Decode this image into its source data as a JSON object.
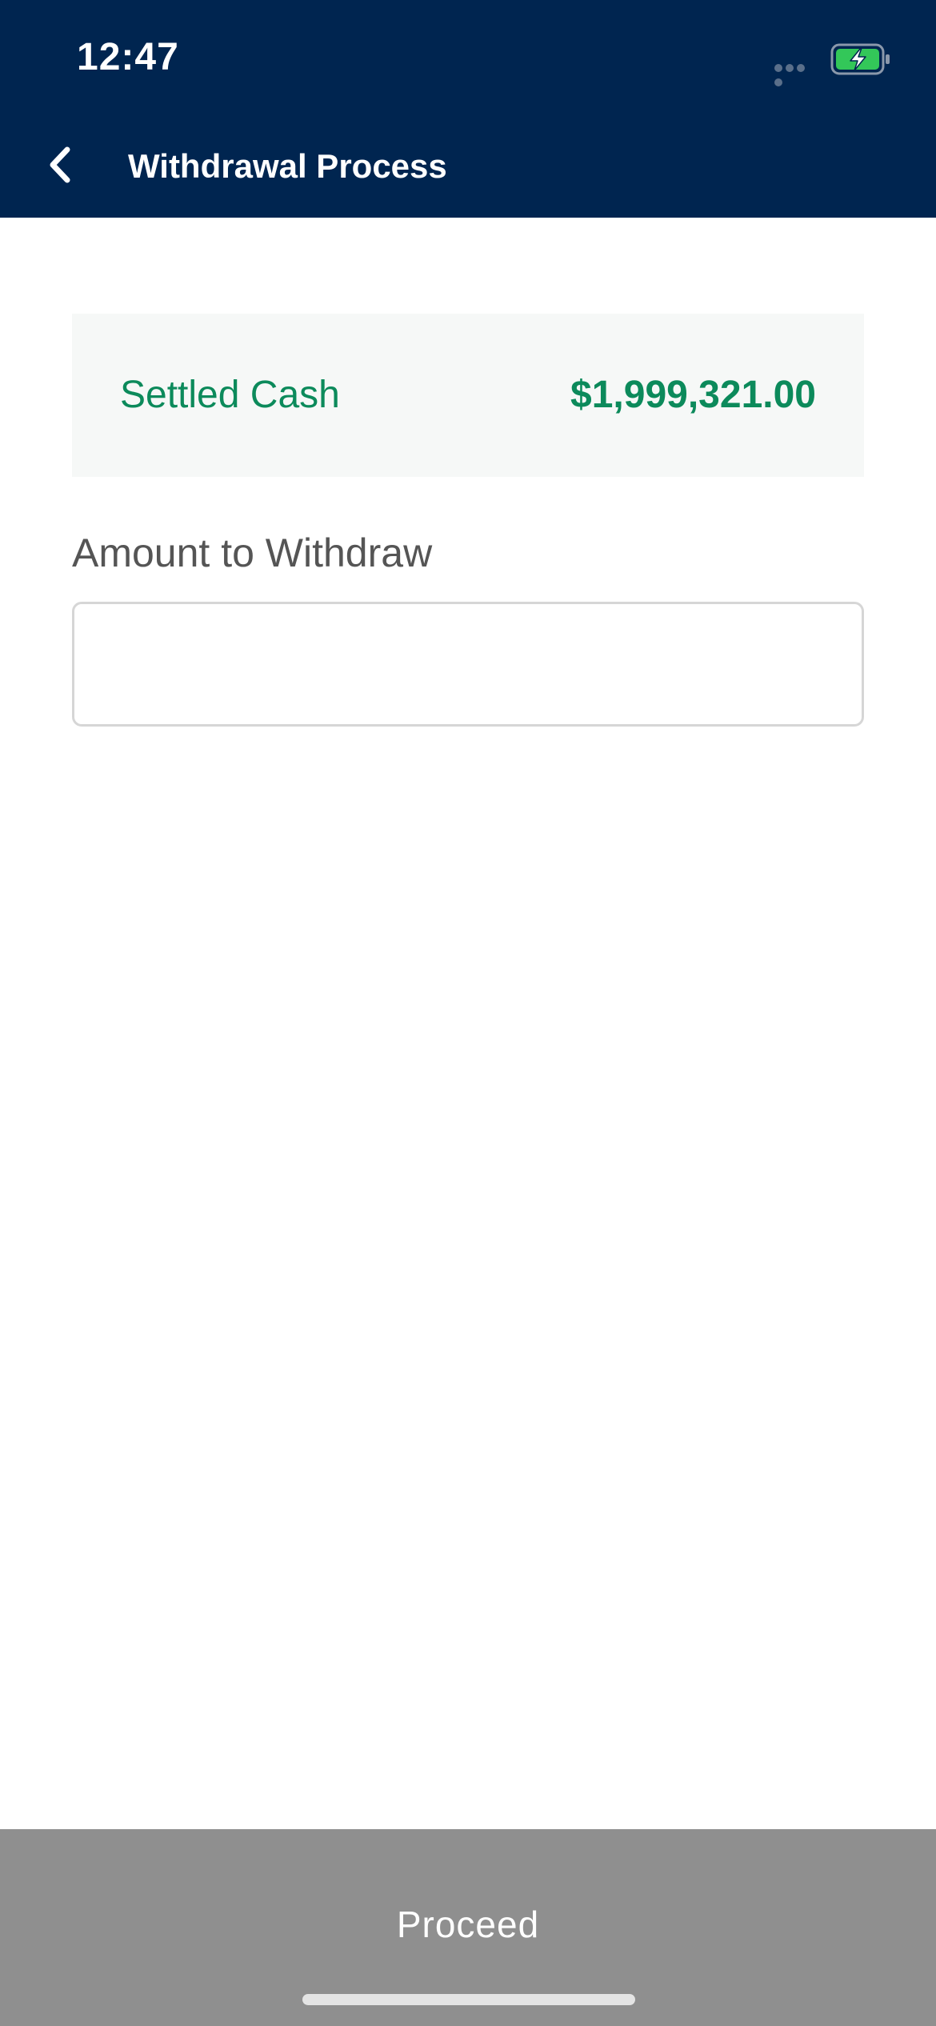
{
  "status_bar": {
    "time": "12:47",
    "battery_icon": "battery-charging-icon",
    "signal_icon": "signal-icon"
  },
  "nav": {
    "back_icon": "chevron-left-icon",
    "title": "Withdrawal Process"
  },
  "cash_card": {
    "label": "Settled Cash",
    "value": "$1,999,321.00"
  },
  "withdraw_form": {
    "label": "Amount to Withdraw",
    "input_value": "",
    "input_placeholder": ""
  },
  "footer": {
    "proceed_label": "Proceed"
  },
  "colors": {
    "header_bg": "#002550",
    "accent_green": "#0c8a5b",
    "battery_green": "#33c759",
    "disabled_button": "#8f8f8f"
  }
}
